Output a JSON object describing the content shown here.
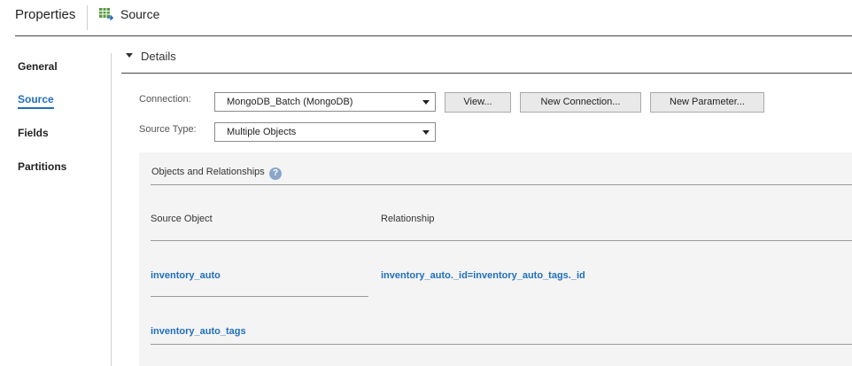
{
  "header": {
    "title": "Properties",
    "source_tab": "Source",
    "source_icon": "table-grid-icon"
  },
  "sidebar": {
    "items": [
      {
        "label": "General",
        "active": false
      },
      {
        "label": "Source",
        "active": true
      },
      {
        "label": "Fields",
        "active": false
      },
      {
        "label": "Partitions",
        "active": false
      }
    ]
  },
  "details": {
    "title": "Details",
    "connection_label": "Connection:",
    "connection_value": "MongoDB_Batch (MongoDB)",
    "source_type_label": "Source Type:",
    "source_type_value": "Multiple Objects",
    "buttons": {
      "view": "View...",
      "new_connection": "New Connection...",
      "new_parameter": "New Parameter..."
    }
  },
  "objects": {
    "title": "Objects and Relationships",
    "help_glyph": "?",
    "columns": {
      "source_object": "Source Object",
      "relationship": "Relationship"
    },
    "rows": [
      {
        "source_object": "inventory_auto",
        "relationship": "inventory_auto._id=inventory_auto_tags._id"
      },
      {
        "source_object": "inventory_auto_tags",
        "relationship": ""
      }
    ]
  },
  "colors": {
    "accent": "#1f6fbf",
    "panel_bg": "#f4f4f4"
  }
}
